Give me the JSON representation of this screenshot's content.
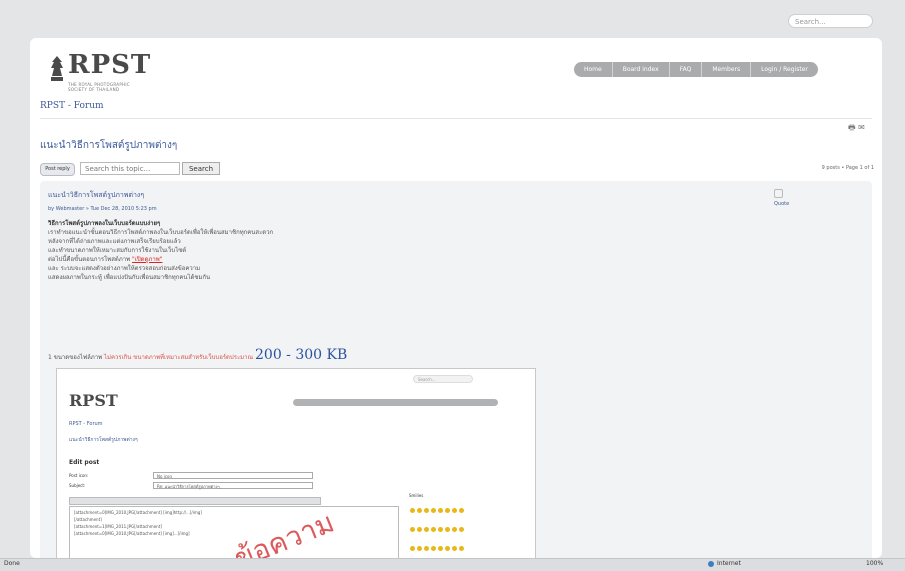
{
  "browser": {
    "search_placeholder": "Search...",
    "status_left": "Done",
    "zone_label": "Internet",
    "zoom_label": "100%"
  },
  "header": {
    "logo_text": "RPST",
    "logo_subtitle_line1": "THE ROYAL PHOTOGRAPHIC",
    "logo_subtitle_line2": "SOCIETY OF THAILAND",
    "nav_items": [
      "Home",
      "Board index",
      "FAQ",
      "Members",
      "Login / Register"
    ]
  },
  "breadcrumb": "RPST - Forum",
  "topic": {
    "title": "แนะนำวิธีการโพสต์รูปภาพต่างๆ",
    "new_post_label": "Post reply",
    "search_placeholder": "Search this topic...",
    "search_button": "Search",
    "page_count": "9 posts • Page 1 of 1"
  },
  "post": {
    "subject": "แนะนำวิธีการโพสต์รูปภาพต่างๆ",
    "byline": "by Webmaster » Tue Dec 28, 2010 5:23 pm",
    "quote_label": "Quote",
    "body_heading": "วิธีการโพสต์รูปภาพลงในเว็บบอร์ดแบบง่ายๆ",
    "body_lines": [
      "เราทำขอแนะนำขั้นตอนวิธีการโพสต์ภาพลงในเว็บบอร์ดเพื่อให้เพื่อนสมาชิกทุกคนสะดวก",
      "หลังจากที่ได้ถ่ายภาพและแต่งภาพเสร็จเรียบร้อยแล้ว",
      "และทำขนาดภาพให้เหมาะสมกับการใช้งานในเว็บไซต์",
      "ต่อไปนี้คือขั้นตอนการโพสต์ภาพ",
      "และ ระบบจะแสดงตัวอย่างภาพให้ตรวจสอบก่อนส่งข้อความ",
      "แสดงผลภาพในกระทู้ เพื่อแบ่งปันกับเพื่อนสมาชิกทุกคนได้ชมกัน"
    ],
    "red_link": "\"เปิดดูภาพ\"",
    "size_prefix": "1 ขนาดของไฟล์ภาพ",
    "size_highlight": "ไม่ควรเกิน",
    "size_middle": "ขนาดภาพที่เหมาะสมสำหรับเว็บบอร์ดประมาณ",
    "size_value": "200 - 300 KB"
  },
  "screenshot": {
    "search_placeholder": "Search...",
    "logo_text": "RPST",
    "crumb": "RPST - Forum",
    "title": "แนะนำวิธีการโพสต์รูปภาพต่างๆ",
    "heading": "Edit post",
    "label_subject": "Subject:",
    "label_icon": "Post icon:",
    "subject_value": "Re: แนะนำวิธีการโพสต์รูปภาพต่างๆ",
    "icon_value": "No icon",
    "smilies_head": "Smilies",
    "editor_lines": [
      "[attachment=0]IMG_2010.JPG[/attachment] [img]http://...[/img]",
      "[/attachment]",
      "[attachment=1]IMG_2011.JPG[/attachment]",
      "",
      "[attachment=0]IMG_2010.JPG[/attachment] [img]...[/img]"
    ],
    "stamp_text": "ข้อความ"
  }
}
